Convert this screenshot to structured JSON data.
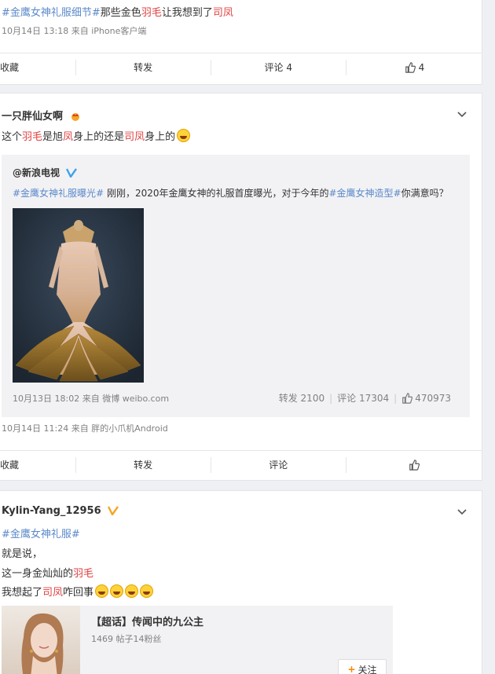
{
  "post1": {
    "text": {
      "tag": "#金鹰女神礼服细节#",
      "t1": "那些金色",
      "feather": "羽毛",
      "t2": "让我想到了",
      "sifeng": "司凤"
    },
    "meta": {
      "time": "10月14日 13:18",
      "from_label": "来自",
      "source": "iPhone客户端"
    },
    "actions": {
      "collect": "收藏",
      "repost": "转发",
      "comment": "评论 4",
      "like": "4"
    }
  },
  "post2": {
    "username": "一只胖仙女啊",
    "text": {
      "t1": "这个",
      "feather": "羽毛",
      "t2": "是旭",
      "feng": "凤",
      "t3": "身上的还是",
      "sifeng": "司凤",
      "t4": "身上的"
    },
    "repost": {
      "author": "@新浪电视",
      "text": {
        "tag1": "#金鹰女神礼服曝光#",
        "t1": " 刚刚，2020年金鹰女神的礼服首度曝光，对于今年的",
        "tag2": "#金鹰女神造型#",
        "t2": "你满意吗？"
      },
      "meta": {
        "time": "10月13日 18:02",
        "from_label": "来自",
        "source": "微博 weibo.com"
      },
      "stats": {
        "repost": "转发 2100",
        "comment": "评论 17304",
        "like": "470973"
      }
    },
    "meta": {
      "time": "10月14日 11:24",
      "from_label": "来自",
      "source": "胖的小爪机Android"
    },
    "actions": {
      "collect": "收藏",
      "repost": "转发",
      "comment": "评论",
      "like": ""
    }
  },
  "post3": {
    "username": "Kylin-Yang_12956",
    "lines": {
      "tag": "#金鹰女神礼服#",
      "l2": "就是说，",
      "l3a": "这一身金灿灿的",
      "l3b": "羽毛",
      "l4a": "我想起了",
      "l4b": "司凤",
      "l4c": "咋回事"
    },
    "topic": {
      "title": "【超话】传闻中的九公主",
      "stats": "1469 帖子14粉丝",
      "follow": "关注"
    }
  },
  "colors": {
    "link": "#5b89c9",
    "highlight": "#e04040",
    "background": "#eef0f3"
  }
}
